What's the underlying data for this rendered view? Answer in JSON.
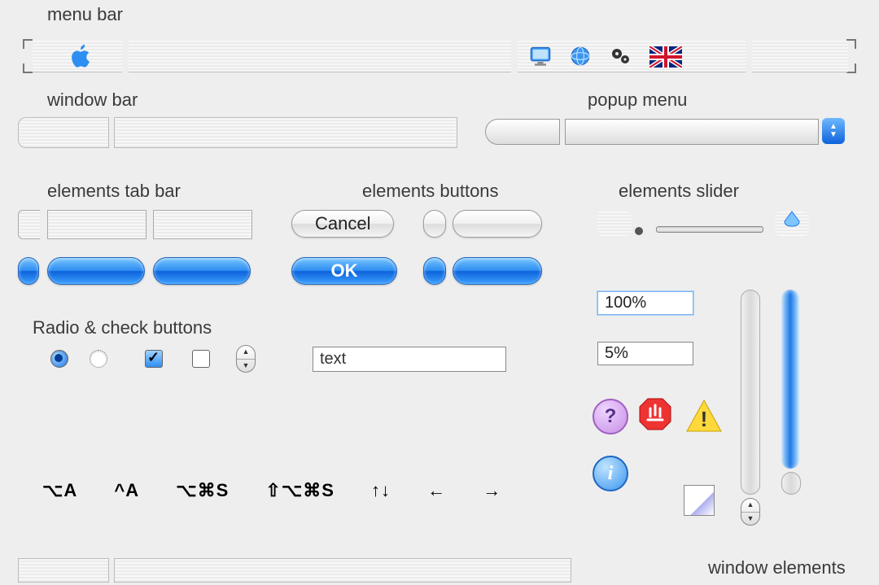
{
  "labels": {
    "menu_bar": "menu bar",
    "window_bar": "window bar",
    "popup_menu": "popup menu",
    "tab_bar": "elements tab bar",
    "buttons": "elements buttons",
    "slider": "elements slider",
    "radio_check": "Radio & check buttons",
    "window_elements": "window elements"
  },
  "buttons": {
    "cancel": "Cancel",
    "ok": "OK"
  },
  "text_input": {
    "value": "text"
  },
  "values": {
    "hundred": "100%",
    "five": "5%"
  },
  "shortcuts": [
    "⌥A",
    "^A",
    "⌥⌘S",
    "⇧⌥⌘S",
    "↑↓",
    "←",
    "→"
  ],
  "menu_icons": [
    "monitor-icon",
    "globe-icon",
    "gears-icon",
    "uk-flag-icon"
  ],
  "dialog_icons": [
    "help-icon",
    "stop-icon",
    "warning-icon",
    "info-icon"
  ],
  "colors": {
    "aqua_blue": "#1f7ae6",
    "panel_gray": "#eeeeee"
  }
}
